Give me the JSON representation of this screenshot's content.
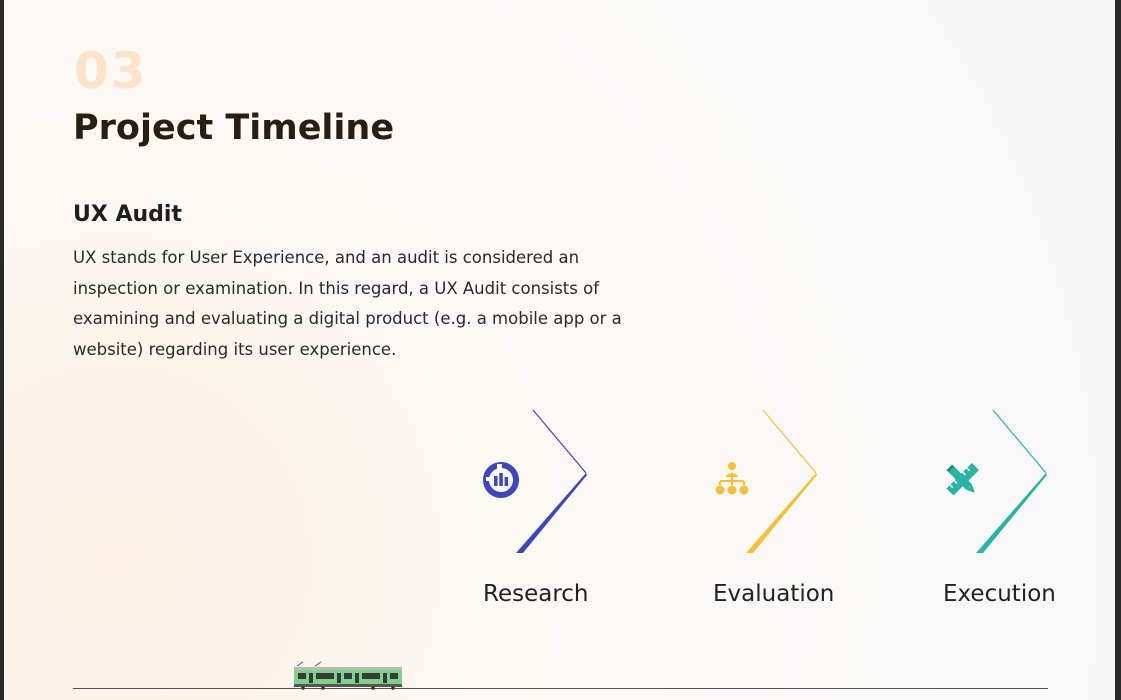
{
  "section_number": "03",
  "title": "Project Timeline",
  "section": {
    "heading": "UX Audit",
    "body": "UX stands for User Experience, and an audit is considered an inspection or examination. In this regard, a UX Audit consists of examining and evaluating a digital product (e.g. a mobile app or a website) regarding its user experience."
  },
  "steps": [
    {
      "label": "Research",
      "icon": "chart-circle-icon",
      "color": "#3f47b8"
    },
    {
      "label": "Evaluation",
      "icon": "hierarchy-icon",
      "color": "#f4c03a"
    },
    {
      "label": "Execution",
      "icon": "ruler-pencil-icon",
      "color": "#2bb3a3"
    }
  ]
}
